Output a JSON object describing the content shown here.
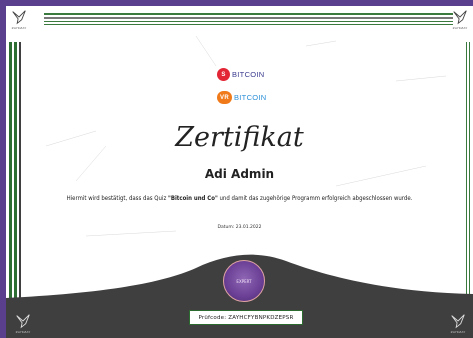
{
  "brand": {
    "corner_label": "ZAYKZAY"
  },
  "partners": [
    {
      "badge": "S",
      "name": "BITCOIN",
      "color": "#e32636"
    },
    {
      "badge": "VR",
      "name": "BITCOIN",
      "color": "#f07a1a"
    }
  ],
  "certificate": {
    "title": "Zertifikat",
    "recipient": "Adi Admin",
    "text_before": "Hiermit wird bestätigt, dass das Quiz ",
    "quiz_name": "\"Bitcoin und Co\"",
    "text_after": "und damit das zugehörige Programm erfolgreich abgeschlossen wurde.",
    "date": "Datum: 23.01.2022",
    "seal_text": "EXPERT",
    "verification_code": "Prüfcode: ZAYHCFYBNPKDZEPSR"
  },
  "colors": {
    "accent_green": "#2f6e33",
    "purple": "#5b3f8f",
    "dark": "#3f3f3f"
  }
}
